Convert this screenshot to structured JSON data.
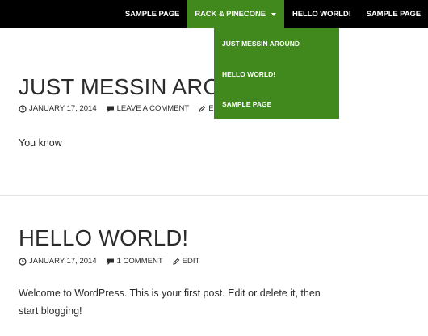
{
  "nav": {
    "items": [
      {
        "label": "SAMPLE PAGE"
      },
      {
        "label": "RACK & PINECONE"
      },
      {
        "label": "HELLO WORLD!"
      },
      {
        "label": "SAMPLE PAGE"
      }
    ],
    "active_color": "#41891c"
  },
  "dropdown": {
    "items": [
      {
        "label": "JUST MESSIN AROUND"
      },
      {
        "label": "HELLO WORLD!"
      },
      {
        "label": "SAMPLE PAGE"
      }
    ]
  },
  "posts": [
    {
      "title": "JUST MESSIN AROUND",
      "date": "JANUARY 17, 2014",
      "comments": "LEAVE A COMMENT",
      "edit": "EDIT",
      "body": "You know"
    },
    {
      "title": "HELLO WORLD!",
      "date": "JANUARY 17, 2014",
      "comments": "1 COMMENT",
      "edit": "EDIT",
      "body": "Welcome to WordPress. This is your first post. Edit or delete it, then start blogging!"
    }
  ],
  "icons": {
    "date": "clock-icon",
    "comments": "comment-bubble-icon",
    "edit": "pencil-icon",
    "dropdown": "caret-down-icon"
  }
}
